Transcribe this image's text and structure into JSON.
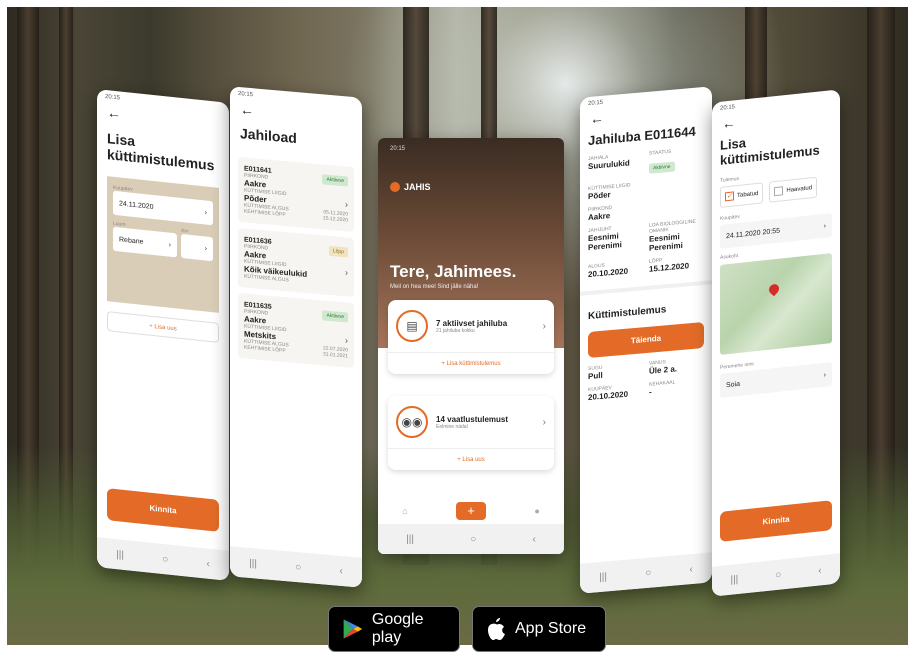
{
  "background_colors": {
    "accent": "#e36b27",
    "badge_ok": "#cfe8cf"
  },
  "phone1": {
    "status": "20:15",
    "title": "Lisa küttimistulemus",
    "date_label": "Kuupäev",
    "date_value": "24.11.2020",
    "loc_label": "Loom",
    "loc_value": "Rebane",
    "count_label": "Arv",
    "add_label": "+ Lisa uus",
    "confirm": "Kinnita"
  },
  "phone2": {
    "status": "20:15",
    "title": "Jahiload",
    "permits": [
      {
        "id": "E011641",
        "status": "Aktiivne",
        "area_label": "PIIRKOND",
        "area": "Aakre",
        "species_label": "KÜTTIMISE LIIGID",
        "species": "Põder",
        "date1_label": "KÜTTIMISE ALGUS",
        "date1": "05.11.2020",
        "date2_label": "KEHTIMISE LÕPP",
        "date2": "15.12.2020"
      },
      {
        "id": "E011636",
        "status": "Lõpp",
        "area_label": "PIIRKOND",
        "area": "Aakre",
        "species_label": "KÜTTIMISE LIIGID",
        "species": "Kõik väikeulukid",
        "date1_label": "KÜTTIMISE ALGUS",
        "date1": "",
        "date2_label": "",
        "date2": ""
      },
      {
        "id": "E011635",
        "status": "Aktiivne",
        "area_label": "PIIRKOND",
        "area": "Aakre",
        "species_label": "KÜTTIMISE LIIGID",
        "species": "Metskits",
        "date1_label": "KÜTTIMISE ALGUS",
        "date1": "22.07.2020",
        "date2_label": "KEHTIMISE LÕPP",
        "date2": "31.01.2021"
      }
    ]
  },
  "phone3": {
    "status": "20:15",
    "brand": "JAHIS",
    "greeting": "Tere, Jahimees.",
    "subtitle": "Meil on hea meel Sind jälle näha!",
    "card1_title": "7 aktiivset jahiluba",
    "card1_sub": "21 jahiluba kokku",
    "card1_link": "+ Lisa küttimistulemus",
    "card2_title": "14 vaatlustulemust",
    "card2_sub": "Eelmine nädal",
    "card2_link": "+ Lisa uus"
  },
  "phone4": {
    "status": "20:15",
    "title": "Jahiluba E011644",
    "status_badge": "Aktiivne",
    "fields": [
      {
        "label": "JAHIALA",
        "value": "Suurulukid"
      },
      {
        "label": "STAATUS",
        "value": ""
      },
      {
        "label": "KÜTTIMISE LIIGID",
        "value": "Põder"
      },
      {
        "label": "",
        "value": ""
      },
      {
        "label": "PIIRKOND",
        "value": "Aakre"
      },
      {
        "label": "",
        "value": ""
      },
      {
        "label": "JAHIJUHT",
        "value": "Eesnimi Perenimi"
      },
      {
        "label": "LOA BIOLOOGILINE OMANIK",
        "value": "Eesnimi Perenimi"
      },
      {
        "label": "ALGUS",
        "value": "20.10.2020"
      },
      {
        "label": "LÕPP",
        "value": "15.12.2020"
      }
    ],
    "section": "Küttimistulemus",
    "fill_btn": "Täienda",
    "result_fields": [
      {
        "label": "SUGU",
        "value": "Pull"
      },
      {
        "label": "VANUS",
        "value": "Üle 2 a."
      },
      {
        "label": "KUUPÄEV",
        "value": "20.10.2020"
      },
      {
        "label": "KEHAKAAL",
        "value": "-"
      }
    ]
  },
  "phone5": {
    "status": "20:15",
    "title": "Lisa küttimistulemus",
    "type_label": "Tulemus",
    "opt1": "Tabatud",
    "opt2": "Haavatud",
    "date_label": "Kuupäev",
    "date_value": "24.11.2020 20:55",
    "map_label": "Asukoht",
    "species_label": "Peremehe nimi",
    "species_value": "Soia",
    "confirm": "Kinnita"
  },
  "stores": {
    "google": "Google play",
    "apple": "App Store"
  }
}
